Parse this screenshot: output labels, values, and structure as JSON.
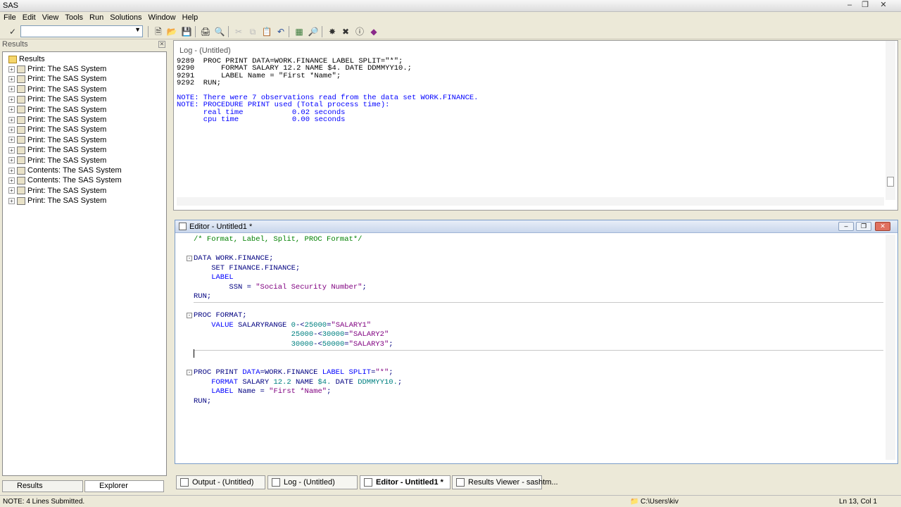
{
  "window": {
    "title": "SAS"
  },
  "menu": [
    "File",
    "Edit",
    "View",
    "Tools",
    "Run",
    "Solutions",
    "Window",
    "Help"
  ],
  "toolbar": {
    "command_value": ""
  },
  "results_pane": {
    "header": "Results",
    "root": "Results",
    "items": [
      "Print:  The SAS System",
      "Print:  The SAS System",
      "Print:  The SAS System",
      "Print:  The SAS System",
      "Print:  The SAS System",
      "Print:  The SAS System",
      "Print:  The SAS System",
      "Print:  The SAS System",
      "Print:  The SAS System",
      "Print:  The SAS System",
      "Contents:  The SAS System",
      "Contents:  The SAS System",
      "Print:  The SAS System",
      "Print:  The SAS System"
    ],
    "tabs": {
      "results": "Results",
      "explorer": "Explorer"
    }
  },
  "log": {
    "title": "Log - (Untitled)",
    "lines": [
      {
        "text": "9289  PROC PRINT DATA=WORK.FINANCE LABEL SPLIT=\"*\";",
        "color": "#000000"
      },
      {
        "text": "9290      FORMAT SALARY 12.2 NAME $4. DATE DDMMYY10.;",
        "color": "#000000"
      },
      {
        "text": "9291      LABEL Name = \"First *Name\";",
        "color": "#000000"
      },
      {
        "text": "9292  RUN;",
        "color": "#000000"
      },
      {
        "text": "",
        "color": "#000000"
      },
      {
        "text": "NOTE: There were 7 observations read from the data set WORK.FINANCE.",
        "color": "#0000ff"
      },
      {
        "text": "NOTE: PROCEDURE PRINT used (Total process time):",
        "color": "#0000ff"
      },
      {
        "text": "      real time           0.02 seconds",
        "color": "#0000ff"
      },
      {
        "text": "      cpu time            0.00 seconds",
        "color": "#0000ff"
      }
    ]
  },
  "editor": {
    "title": "Editor - Untitled1 *",
    "lines": [
      {
        "row": 0,
        "segs": [
          {
            "t": "/* Format, Label, Split, PROC Format*/",
            "c": "#008000"
          }
        ]
      },
      {
        "row": 2,
        "fold": true,
        "segs": [
          {
            "t": "DATA WORK.FINANCE;",
            "c": "#000080"
          }
        ]
      },
      {
        "row": 3,
        "segs": [
          {
            "t": "    SET FINANCE.FINANCE;",
            "c": "#000080"
          }
        ]
      },
      {
        "row": 4,
        "segs": [
          {
            "t": "    LABEL",
            "c": "#0000ff"
          }
        ]
      },
      {
        "row": 5,
        "segs": [
          {
            "t": "        SSN = ",
            "c": "#000080"
          },
          {
            "t": "\"Social Security Number\"",
            "c": "#800080"
          },
          {
            "t": ";",
            "c": "#000080"
          }
        ]
      },
      {
        "row": 6,
        "segs": [
          {
            "t": "RUN;",
            "c": "#000080"
          }
        ]
      },
      {
        "row": 8,
        "fold": true,
        "segs": [
          {
            "t": "PROC FORMAT;",
            "c": "#000080"
          }
        ]
      },
      {
        "row": 9,
        "segs": [
          {
            "t": "    VALUE",
            "c": "#0000ff"
          },
          {
            "t": " SALARYRANGE ",
            "c": "#000080"
          },
          {
            "t": "0",
            "c": "#008080"
          },
          {
            "t": "-<",
            "c": "#000080"
          },
          {
            "t": "25000",
            "c": "#008080"
          },
          {
            "t": "=",
            "c": "#000080"
          },
          {
            "t": "\"SALARY1\"",
            "c": "#800080"
          }
        ]
      },
      {
        "row": 10,
        "segs": [
          {
            "t": "                      ",
            "c": "#000080"
          },
          {
            "t": "25000",
            "c": "#008080"
          },
          {
            "t": "-<",
            "c": "#000080"
          },
          {
            "t": "30000",
            "c": "#008080"
          },
          {
            "t": "=",
            "c": "#000080"
          },
          {
            "t": "\"SALARY2\"",
            "c": "#800080"
          }
        ]
      },
      {
        "row": 11,
        "segs": [
          {
            "t": "                      ",
            "c": "#000080"
          },
          {
            "t": "30000",
            "c": "#008080"
          },
          {
            "t": "-<",
            "c": "#000080"
          },
          {
            "t": "50000",
            "c": "#008080"
          },
          {
            "t": "=",
            "c": "#000080"
          },
          {
            "t": "\"SALARY3\"",
            "c": "#800080"
          },
          {
            "t": ";",
            "c": "#000080"
          }
        ]
      },
      {
        "row": 12,
        "segs": [
          {
            "t": "",
            "c": "#000080"
          }
        ]
      },
      {
        "row": 14,
        "fold": true,
        "segs": [
          {
            "t": "PROC PRINT",
            "c": "#000080"
          },
          {
            "t": " DATA",
            "c": "#0000ff"
          },
          {
            "t": "=WORK.FINANCE ",
            "c": "#000080"
          },
          {
            "t": "LABEL SPLIT",
            "c": "#0000ff"
          },
          {
            "t": "=",
            "c": "#000080"
          },
          {
            "t": "\"*\"",
            "c": "#800080"
          },
          {
            "t": ";",
            "c": "#000080"
          }
        ]
      },
      {
        "row": 15,
        "segs": [
          {
            "t": "    FORMAT",
            "c": "#0000ff"
          },
          {
            "t": " SALARY ",
            "c": "#000080"
          },
          {
            "t": "12.2",
            "c": "#008080"
          },
          {
            "t": " NAME ",
            "c": "#000080"
          },
          {
            "t": "$4.",
            "c": "#008080"
          },
          {
            "t": " DATE ",
            "c": "#000080"
          },
          {
            "t": "DDMMYY10.",
            "c": "#008080"
          },
          {
            "t": ";",
            "c": "#000080"
          }
        ]
      },
      {
        "row": 16,
        "segs": [
          {
            "t": "    LABEL",
            "c": "#0000ff"
          },
          {
            "t": " Name = ",
            "c": "#000080"
          },
          {
            "t": "\"First *Name\"",
            "c": "#800080"
          },
          {
            "t": ";",
            "c": "#000080"
          }
        ]
      },
      {
        "row": 17,
        "segs": [
          {
            "t": "RUN;",
            "c": "#000080"
          }
        ]
      }
    ]
  },
  "taskbar": {
    "tabs": [
      "Output - (Untitled)",
      "Log - (Untitled)",
      "Editor - Untitled1 *",
      "Results Viewer - sashtm..."
    ]
  },
  "status": {
    "message": "NOTE: 4 Lines Submitted.",
    "path": "C:\\Users\\kiv",
    "position": "Ln 13, Col 1"
  }
}
